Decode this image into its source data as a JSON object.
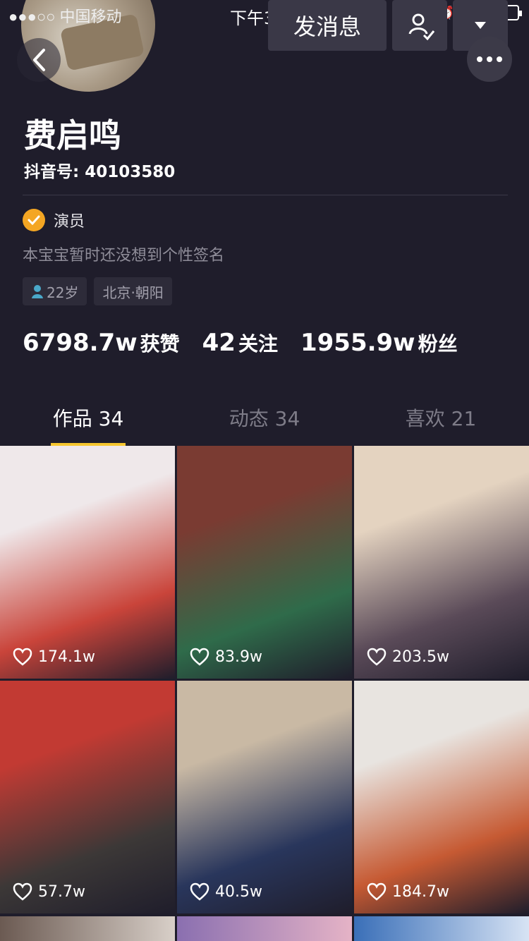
{
  "status_bar": {
    "carrier": "●●●○○ 中国移动",
    "time": "下午3:00"
  },
  "header": {
    "send_message_label": "发消息",
    "follow_icon": "user-check-icon",
    "dropdown_icon": "triangle-down-icon",
    "more_icon": "more-dots-icon",
    "back_icon": "back-chevron-icon"
  },
  "profile": {
    "name": "费启鸣",
    "douyin_id": "抖音号: 40103580",
    "verified_label": "演员",
    "signature": "本宝宝暂时还没想到个性签名",
    "tags": {
      "age": "22岁",
      "location": "北京·朝阳"
    }
  },
  "stats": {
    "likes_value": "6798.7w",
    "likes_label": "获赞",
    "following_value": "42",
    "following_label": "关注",
    "fans_value": "1955.9w",
    "fans_label": "粉丝"
  },
  "tabs": [
    {
      "label": "作品 34"
    },
    {
      "label": "动态 34"
    },
    {
      "label": "喜欢 21"
    }
  ],
  "videos": [
    {
      "likes": "174.1w",
      "color_a": "#c9443a",
      "color_b": "#efe8ea"
    },
    {
      "likes": "83.9w",
      "color_a": "#2f6b4a",
      "color_b": "#7a3b32"
    },
    {
      "likes": "203.5w",
      "color_a": "#5a4a58",
      "color_b": "#e4d3c0"
    },
    {
      "likes": "57.7w",
      "color_a": "#3c3837",
      "color_b": "#c23a33"
    },
    {
      "likes": "40.5w",
      "color_a": "#29365c",
      "color_b": "#c9b9a4"
    },
    {
      "likes": "184.7w",
      "color_a": "#c65a33",
      "color_b": "#e8e4e0"
    }
  ],
  "colors": {
    "accent": "#f6c62e",
    "background": "#1f1d2b",
    "verified": "#f4a623"
  }
}
